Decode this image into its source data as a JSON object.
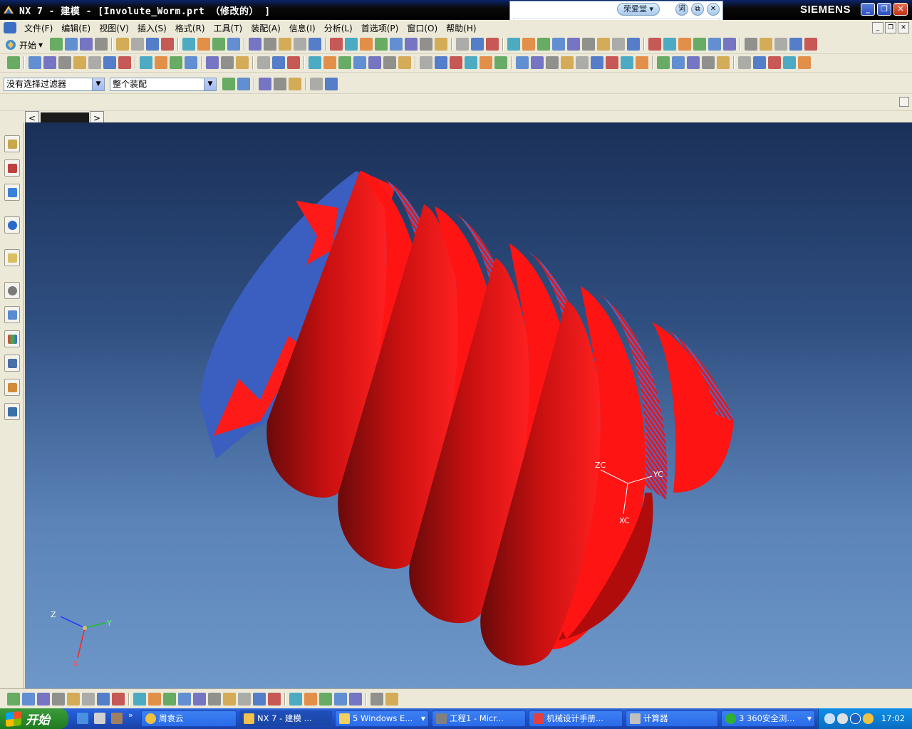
{
  "window": {
    "title": "NX 7 - 建模 - [Involute_Worm.prt （修改的） ]",
    "brand": "SIEMENS"
  },
  "ime": {
    "name": "荣爱堂",
    "word_btn": "词"
  },
  "menu": {
    "items": [
      "文件(F)",
      "编辑(E)",
      "视图(V)",
      "插入(S)",
      "格式(R)",
      "工具(T)",
      "装配(A)",
      "信息(I)",
      "分析(L)",
      "首选项(P)",
      "窗口(O)",
      "帮助(H)"
    ]
  },
  "toolbar": {
    "start_label": "开始",
    "selection_filter": "没有选择过滤器",
    "scope": "整个装配"
  },
  "viewport": {
    "wcs_labels": {
      "zc": "ZC",
      "yc": "YC",
      "xc": "XC"
    },
    "abs_labels": {
      "z": "Z",
      "y": "Y",
      "x": "X"
    },
    "model_color": "#ff1a1a",
    "facet_color": "#3a5fc0"
  },
  "taskbar": {
    "start": "开始",
    "tasks": [
      {
        "label": "周袁云"
      },
      {
        "label": "NX 7 - 建模 ..."
      },
      {
        "label": "5 Windows E..."
      },
      {
        "label": "工程1 - Micr..."
      },
      {
        "label": "机械设计手册..."
      },
      {
        "label": "计算器"
      },
      {
        "label": "3 360安全浏..."
      }
    ],
    "clock": "17:02"
  }
}
